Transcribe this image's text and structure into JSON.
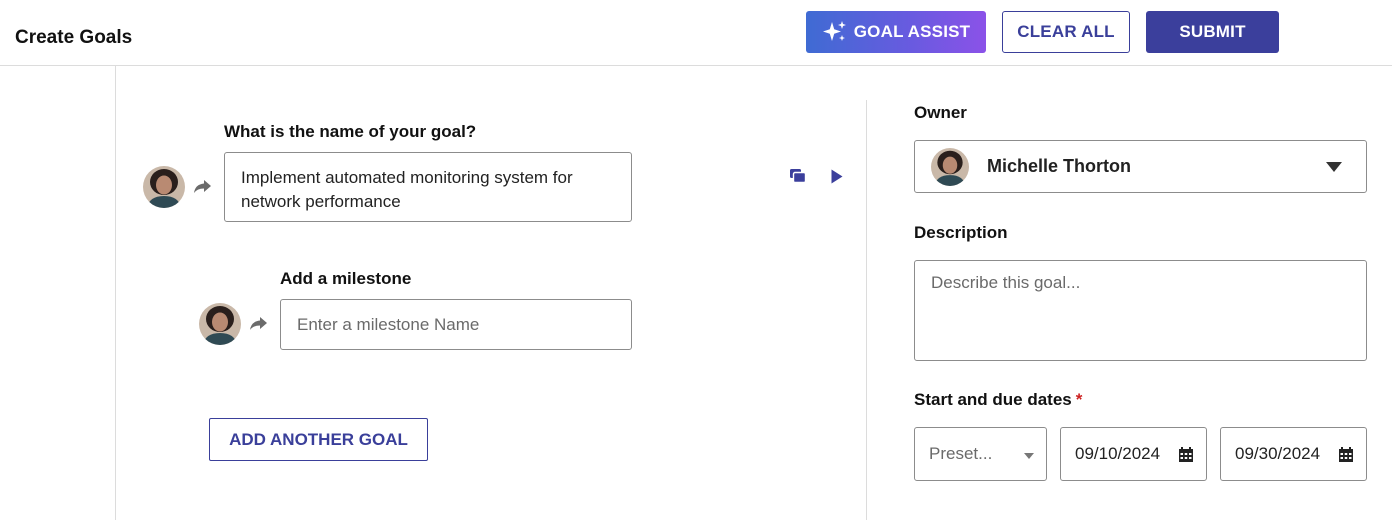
{
  "header": {
    "title": "Create Goals",
    "goal_assist_label": "GOAL ASSIST",
    "clear_all_label": "CLEAR ALL",
    "submit_label": "SUBMIT"
  },
  "goal": {
    "name_label": "What is the name of your goal?",
    "name_value": "Implement automated monitoring system for network performance",
    "milestone_label": "Add a milestone",
    "milestone_placeholder": "Enter a milestone Name",
    "add_another_label": "ADD ANOTHER GOAL"
  },
  "details": {
    "owner_label": "Owner",
    "owner_name": "Michelle Thorton",
    "description_label": "Description",
    "description_placeholder": "Describe this goal...",
    "dates_label": "Start and due dates",
    "required_marker": "*",
    "preset_placeholder": "Preset...",
    "start_date": "09/10/2024",
    "due_date": "09/30/2024"
  },
  "icons": {
    "goal_assist": "sparkle-icon",
    "forward": "share-arrow-icon",
    "copy": "copy-icon",
    "play": "play-icon",
    "dropdown": "caret-down-icon",
    "calendar": "calendar-icon"
  },
  "colors": {
    "primary": "#3b3f9c",
    "assist_gradient_start": "#3f6bd3",
    "assist_gradient_end": "#8b52e8",
    "required": "#cc1f1f",
    "border": "#8c8c8c"
  }
}
